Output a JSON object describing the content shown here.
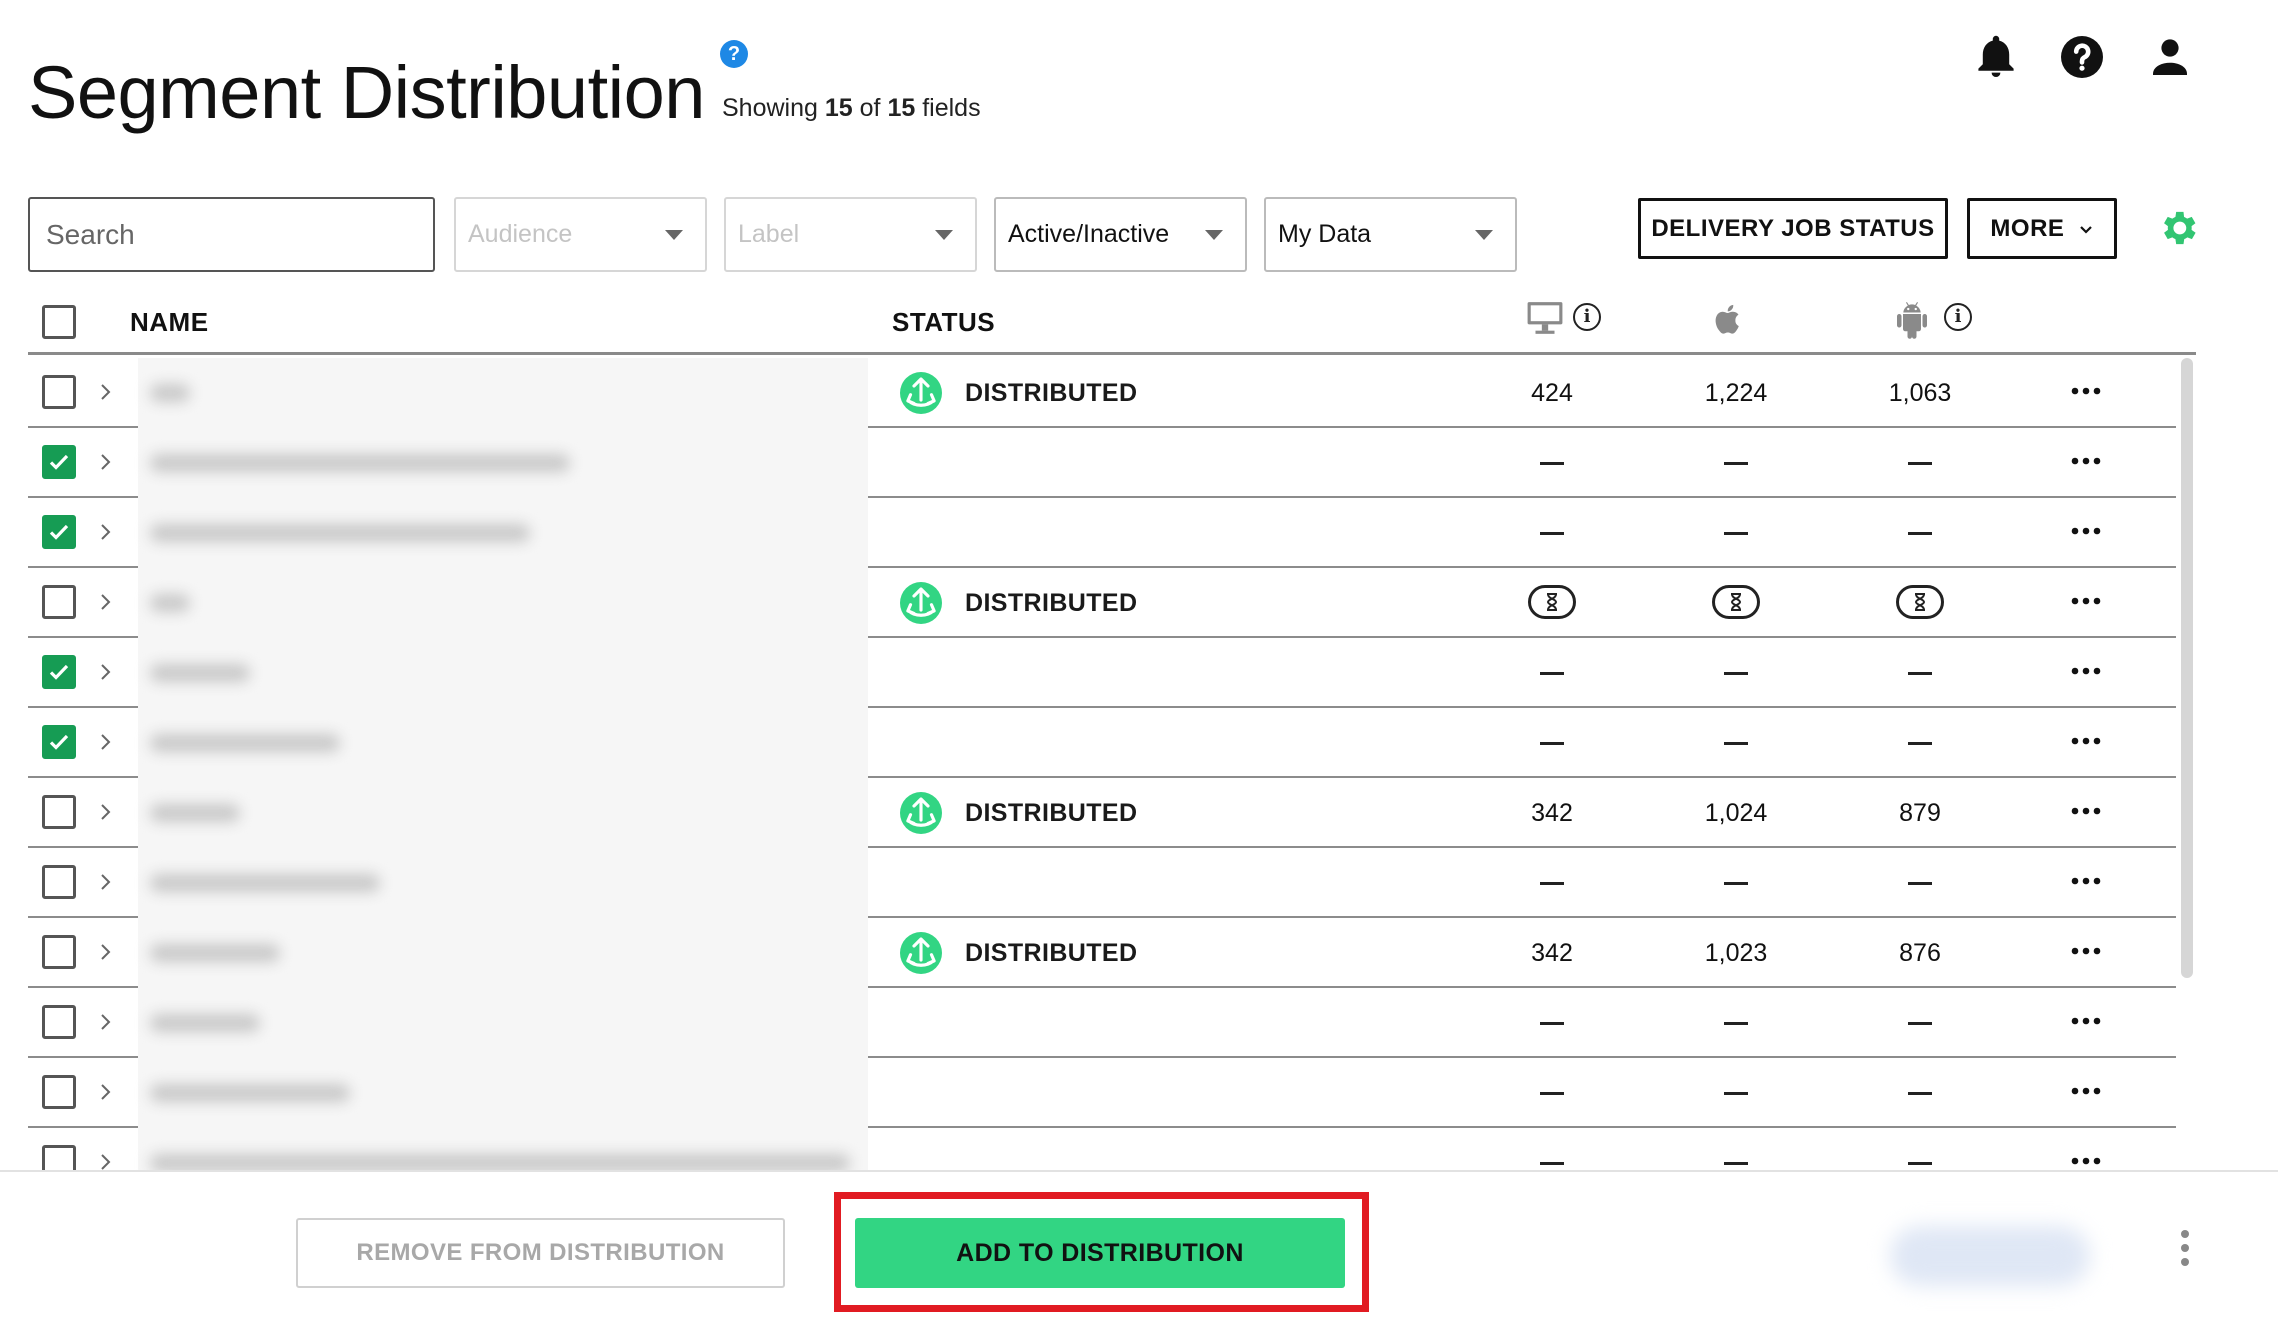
{
  "header": {
    "title": "Segment Distribution",
    "showing_prefix": "Showing",
    "showing_count": "15",
    "showing_of": "of",
    "showing_total": "15",
    "showing_suffix": "fields",
    "help_glyph": "?"
  },
  "top_icons": [
    "bell-icon",
    "help-circle-icon",
    "user-icon"
  ],
  "filters": {
    "search_placeholder": "Search",
    "audience": "Audience",
    "label": "Label",
    "active_inactive": "Active/Inactive",
    "my_data": "My Data"
  },
  "toolbar": {
    "delivery_job_status": "DELIVERY JOB STATUS",
    "more": "MORE"
  },
  "table": {
    "col_name": "NAME",
    "col_status": "STATUS",
    "platform_icons": [
      "desktop-icon",
      "apple-icon",
      "android-icon"
    ],
    "rows": [
      {
        "checked": false,
        "status": "DISTRIBUTED",
        "cells": [
          "424",
          "1,224",
          "1,063"
        ]
      },
      {
        "checked": true,
        "status": "",
        "cells": [
          "—",
          "—",
          "—"
        ]
      },
      {
        "checked": true,
        "status": "",
        "cells": [
          "—",
          "—",
          "—"
        ]
      },
      {
        "checked": false,
        "status": "DISTRIBUTED",
        "cells": [
          "pending",
          "pending",
          "pending"
        ]
      },
      {
        "checked": true,
        "status": "",
        "cells": [
          "—",
          "—",
          "—"
        ]
      },
      {
        "checked": true,
        "status": "",
        "cells": [
          "—",
          "—",
          "—"
        ]
      },
      {
        "checked": false,
        "status": "DISTRIBUTED",
        "cells": [
          "342",
          "1,024",
          "879"
        ]
      },
      {
        "checked": false,
        "status": "",
        "cells": [
          "—",
          "—",
          "—"
        ]
      },
      {
        "checked": false,
        "status": "DISTRIBUTED",
        "cells": [
          "342",
          "1,023",
          "876"
        ]
      },
      {
        "checked": false,
        "status": "",
        "cells": [
          "—",
          "—",
          "—"
        ]
      },
      {
        "checked": false,
        "status": "",
        "cells": [
          "—",
          "—",
          "—"
        ]
      },
      {
        "checked": false,
        "status": "",
        "cells": [
          "—",
          "—",
          "—"
        ]
      }
    ]
  },
  "footer": {
    "remove_label": "REMOVE FROM DISTRIBUTION",
    "add_label": "ADD TO DISTRIBUTION"
  },
  "colors": {
    "accent_green": "#32d583",
    "check_green": "#169c54",
    "highlight_red": "#e11b22",
    "help_blue": "#1e88e5"
  }
}
